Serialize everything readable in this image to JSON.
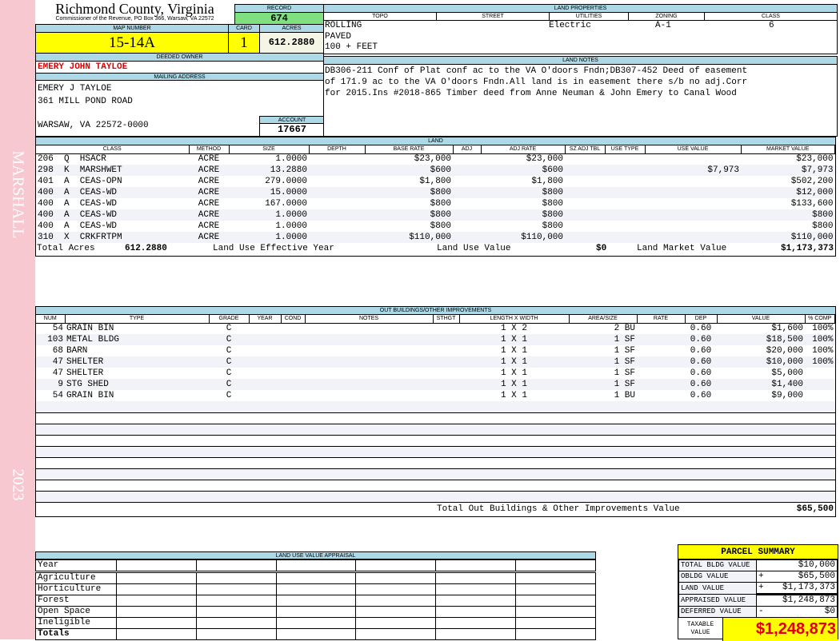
{
  "sidebar": {
    "district": "MARSHALL",
    "year": "2023"
  },
  "header": {
    "county": "Richmond County, Virginia",
    "subtitle": "Commissioner of the Revenue, PO Box 366, Warsaw, VA 22572",
    "record_label": "RECORD",
    "record": "674",
    "map_number_label": "MAP NUMBER",
    "map_number": "15-14A",
    "card_label": "CARD",
    "card": "1",
    "acres_label": "ACRES",
    "acres": "612.2880"
  },
  "owner": {
    "deeded_label": "DEEDED OWNER",
    "deeded_owner": "EMERY JOHN TAYLOE",
    "mailing_label": "MAILING ADDRESS",
    "line1": "EMERY J TAYLOE",
    "line2": "361 MILL POND ROAD",
    "line3": "WARSAW, VA 22572-0000",
    "account_label": "ACCOUNT",
    "account": "17667"
  },
  "land_properties": {
    "title": "LAND PROPERTIES",
    "columns": [
      "TOPO",
      "STREET",
      "UTILITIES",
      "ZONING",
      "CLASS"
    ],
    "topo": [
      "ROLLING",
      "PAVED",
      "100 + FEET"
    ],
    "utilities": "Electric",
    "zoning": "A-1",
    "class": "6"
  },
  "land_notes": {
    "title": "LAND NOTES",
    "lines": [
      "DB306-211 Conf of Plat conf ac to the VA O'doors Fndn;DB307-452 Deed of easement",
      "of 171.9 ac to the VA O'doors Fndn.All land is in easement there s/b no adj.Corr",
      "for 2015.Ins #2018-865 Timber deed from Anne Neuman & John Emery to Canal Wood"
    ]
  },
  "land": {
    "title": "LAND",
    "columns": [
      "CLASS",
      "METHOD",
      "SIZE",
      "DEPTH",
      "BASE RATE",
      "ADJ",
      "ADJ RATE",
      "SZ ADJ TBL",
      "USE TYPE",
      "USE VALUE",
      "MARKET VALUE"
    ],
    "rows": [
      [
        "206  Q  HSACR",
        "ACRE",
        "1.0000",
        "",
        "$23,000",
        "",
        "$23,000",
        "",
        "",
        "",
        "$23,000"
      ],
      [
        "298  K  MARSHWET",
        "ACRE",
        "13.2880",
        "",
        "$600",
        "",
        "$600",
        "",
        "",
        "$7,973",
        "$7,973"
      ],
      [
        "401  A  CEAS-OPN",
        "ACRE",
        "279.0000",
        "",
        "$1,800",
        "",
        "$1,800",
        "",
        "",
        "",
        "$502,200"
      ],
      [
        "400  A  CEAS-WD",
        "ACRE",
        "15.0000",
        "",
        "$800",
        "",
        "$800",
        "",
        "",
        "",
        "$12,000"
      ],
      [
        "400  A  CEAS-WD",
        "ACRE",
        "167.0000",
        "",
        "$800",
        "",
        "$800",
        "",
        "",
        "",
        "$133,600"
      ],
      [
        "400  A  CEAS-WD",
        "ACRE",
        "1.0000",
        "",
        "$800",
        "",
        "$800",
        "",
        "",
        "",
        "$800"
      ],
      [
        "400  A  CEAS-WD",
        "ACRE",
        "1.0000",
        "",
        "$800",
        "",
        "$800",
        "",
        "",
        "",
        "$800"
      ],
      [
        "310  X  CRKFRTPM",
        "ACRE",
        "1.0000",
        "",
        "$110,000",
        "",
        "$110,000",
        "",
        "",
        "",
        "$110,000"
      ]
    ],
    "total_acres_label": "Total Acres",
    "total_acres": "612.2880",
    "effective_year_label": "Land Use Effective Year",
    "use_value_label": "Land Use Value",
    "use_value": "$0",
    "market_value_label": "Land Market Value",
    "market_value": "$1,173,373"
  },
  "outbuildings": {
    "title": "OUT BUILDINGS/OTHER IMPROVEMENTS",
    "columns": [
      "NUM",
      "TYPE",
      "GRADE",
      "YEAR",
      "COND",
      "NOTES",
      "STHGT",
      "LENGTH X WIDTH",
      "AREA/SIZE",
      "RATE",
      "DEP",
      "VALUE",
      "% COMP"
    ],
    "rows": [
      [
        "54",
        "GRAIN BIN",
        "C",
        "",
        "",
        "",
        "",
        "1 X 2",
        "2 BU",
        "",
        "0.60",
        "$1,600",
        "100%"
      ],
      [
        "103",
        "METAL BLDG",
        "C",
        "",
        "",
        "",
        "",
        "1 X 1",
        "1 SF",
        "",
        "0.60",
        "$18,500",
        "100%"
      ],
      [
        "68",
        "BARN",
        "C",
        "",
        "",
        "",
        "",
        "1 X 1",
        "1 SF",
        "",
        "0.60",
        "$20,000",
        "100%"
      ],
      [
        "47",
        "SHELTER",
        "C",
        "",
        "",
        "",
        "",
        "1 X 1",
        "1 SF",
        "",
        "0.60",
        "$10,000",
        "100%"
      ],
      [
        "47",
        "SHELTER",
        "C",
        "",
        "",
        "",
        "",
        "1 X 1",
        "1 SF",
        "",
        "0.60",
        "$5,000",
        ""
      ],
      [
        "9",
        "STG SHED",
        "C",
        "",
        "",
        "",
        "",
        "1 X 1",
        "1 SF",
        "",
        "0.60",
        "$1,400",
        ""
      ],
      [
        "54",
        "GRAIN BIN",
        "C",
        "",
        "",
        "",
        "",
        "1 X 1",
        "1 BU",
        "",
        "0.60",
        "$9,000",
        ""
      ]
    ],
    "total_label": "Total Out Buildings & Other Improvements Value",
    "total": "$65,500"
  },
  "land_use": {
    "title": "LAND USE VALUE APPRAISAL",
    "rows": [
      "Year",
      "Agriculture",
      "Horticulture",
      "Forest",
      "Open Space",
      "Ineligible",
      "Totals"
    ]
  },
  "summary": {
    "title": "PARCEL SUMMARY",
    "rows": [
      [
        "TOTAL BLDG VALUE",
        "",
        "$10,000"
      ],
      [
        "OBLDG VALUE",
        "+",
        "$65,500"
      ],
      [
        "LAND VALUE",
        "+",
        "$1,173,373"
      ],
      [
        "APPRAISED VALUE",
        "",
        "$1,248,873"
      ],
      [
        "DEFERRED VALUE",
        "-",
        "$0"
      ]
    ],
    "taxable_label": "TAXABLE VALUE",
    "taxable": "$1,248,873"
  }
}
